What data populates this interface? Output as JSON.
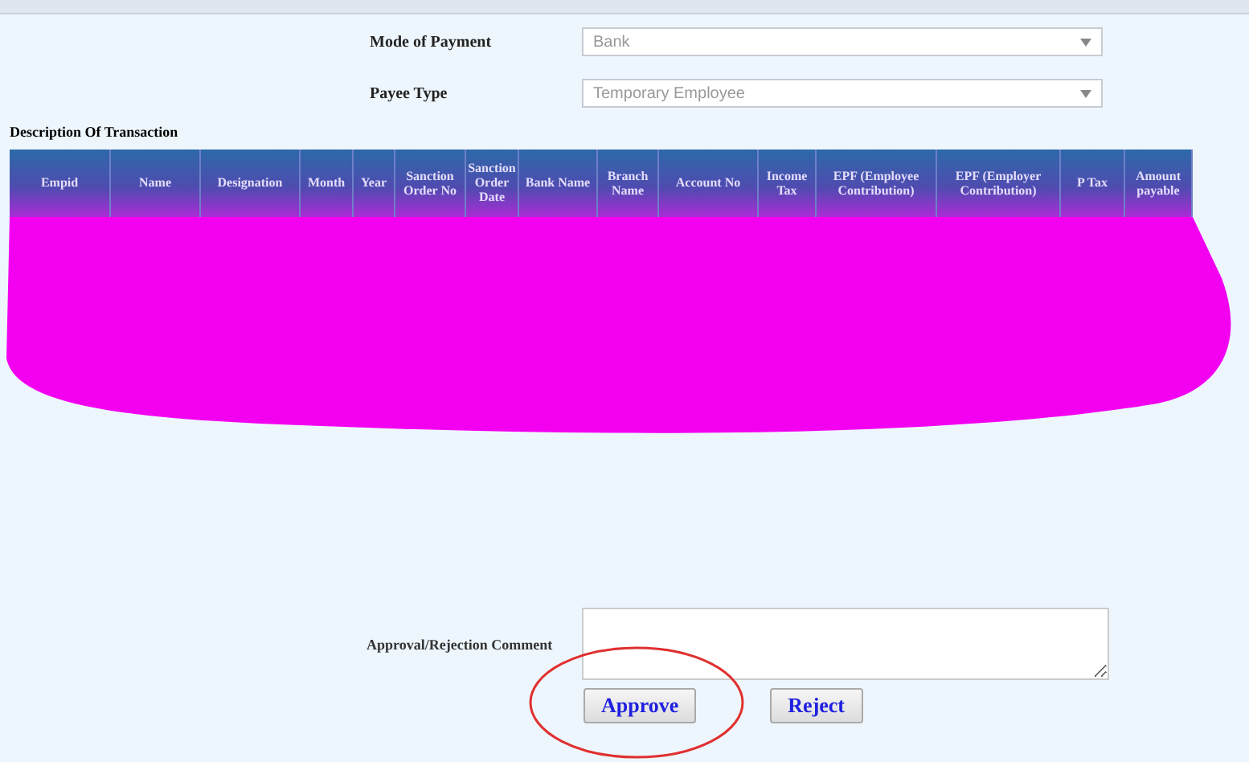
{
  "fields": [
    {
      "label": "Mode of Payment",
      "value": "Bank"
    },
    {
      "label": "Payee Type",
      "value": "Temporary Employee"
    }
  ],
  "section_title": "Description Of Transaction",
  "table": {
    "columns": [
      "Empid",
      "Name",
      "Designation",
      "Month",
      "Year",
      "Sanction Order No",
      "Sanction Order Date",
      "Bank Name",
      "Branch Name",
      "Account No",
      "Income Tax",
      "EPF (Employee Contribution)",
      "EPF (Employer Contribution)",
      "P Tax",
      "Amount payable"
    ]
  },
  "comment": {
    "label": "Approval/Rejection Comment"
  },
  "buttons": [
    {
      "label": "Approve",
      "circled": true
    },
    {
      "label": "Reject",
      "circled": false
    }
  ]
}
